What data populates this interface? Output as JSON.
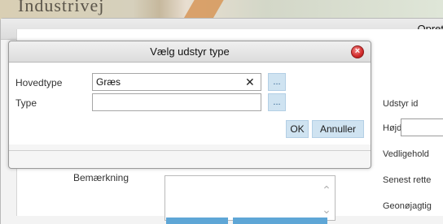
{
  "map": {
    "label": "Industrivej"
  },
  "back_dialog": {
    "title": "Opret",
    "labels": {
      "udstyr_id": "Udstyr id",
      "hojde": "Højde",
      "vedligehold": "Vedligehold",
      "senest_rettet": "Senest rette",
      "geonojagtighed": "Geonøjagtig",
      "bemaerkning": "Bemærkning"
    }
  },
  "dialog": {
    "title": "Vælg udstyr type",
    "fields": [
      {
        "label": "Hovedtype",
        "value": "Græs",
        "clear": "✕",
        "browse": "..."
      },
      {
        "label": "Type",
        "value": "",
        "browse": "..."
      }
    ],
    "buttons": {
      "ok": "OK",
      "cancel": "Annuller"
    }
  },
  "icons": {
    "close": "close-circle-icon",
    "scroll_up": "chevron-up-icon",
    "scroll_down": "chevron-down-icon"
  },
  "colors": {
    "accent_button": "#cfe3f1",
    "close_red": "#d12a2a"
  }
}
